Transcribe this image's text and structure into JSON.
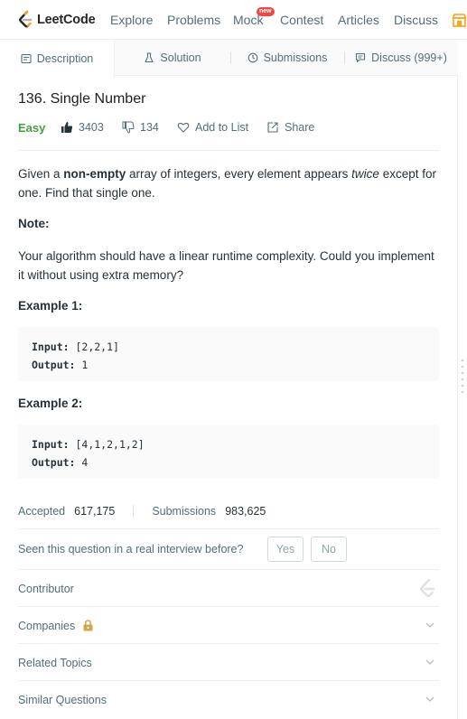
{
  "nav": {
    "logo_text": "LeetCode",
    "items": [
      "Explore",
      "Problems",
      "Mock",
      "Contest",
      "Articles",
      "Discuss"
    ],
    "new_badge": "new"
  },
  "tabs": [
    {
      "label": "Description",
      "icon": "description-icon"
    },
    {
      "label": "Solution",
      "icon": "flask-icon"
    },
    {
      "label": "Submissions",
      "icon": "clock-icon"
    },
    {
      "label": "Discuss (999+)",
      "icon": "comment-icon"
    }
  ],
  "problem": {
    "title": "136. Single Number",
    "difficulty": "Easy",
    "likes": "3403",
    "dislikes": "134",
    "add_to_list": "Add to List",
    "share": "Share",
    "desc_prefix": "Given a ",
    "desc_bold": "non-empty",
    "desc_mid": " array of integers, every element appears ",
    "desc_italic": "twice",
    "desc_suffix": " except for one. Find that single one.",
    "note_heading": "Note:",
    "note_text": "Your algorithm should have a linear runtime complexity. Could you implement it without using extra memory?",
    "examples": [
      {
        "heading": "Example 1:",
        "input_label": "Input:",
        "input": "[2,2,1]",
        "output_label": "Output:",
        "output": "1"
      },
      {
        "heading": "Example 2:",
        "input_label": "Input:",
        "input": "[4,1,2,1,2]",
        "output_label": "Output:",
        "output": "4"
      }
    ]
  },
  "stats": {
    "accepted_label": "Accepted",
    "accepted": "617,175",
    "submissions_label": "Submissions",
    "submissions": "983,625"
  },
  "interview": {
    "question": "Seen this question in a real interview before?",
    "yes": "Yes",
    "no": "No"
  },
  "sections": {
    "contributor": "Contributor",
    "companies": "Companies",
    "related_topics": "Related Topics",
    "similar_questions": "Similar Questions"
  },
  "colors": {
    "accent": "#ffa116",
    "easy": "#43a047",
    "badge": "#ef4743",
    "lock": "#d4a74a"
  }
}
